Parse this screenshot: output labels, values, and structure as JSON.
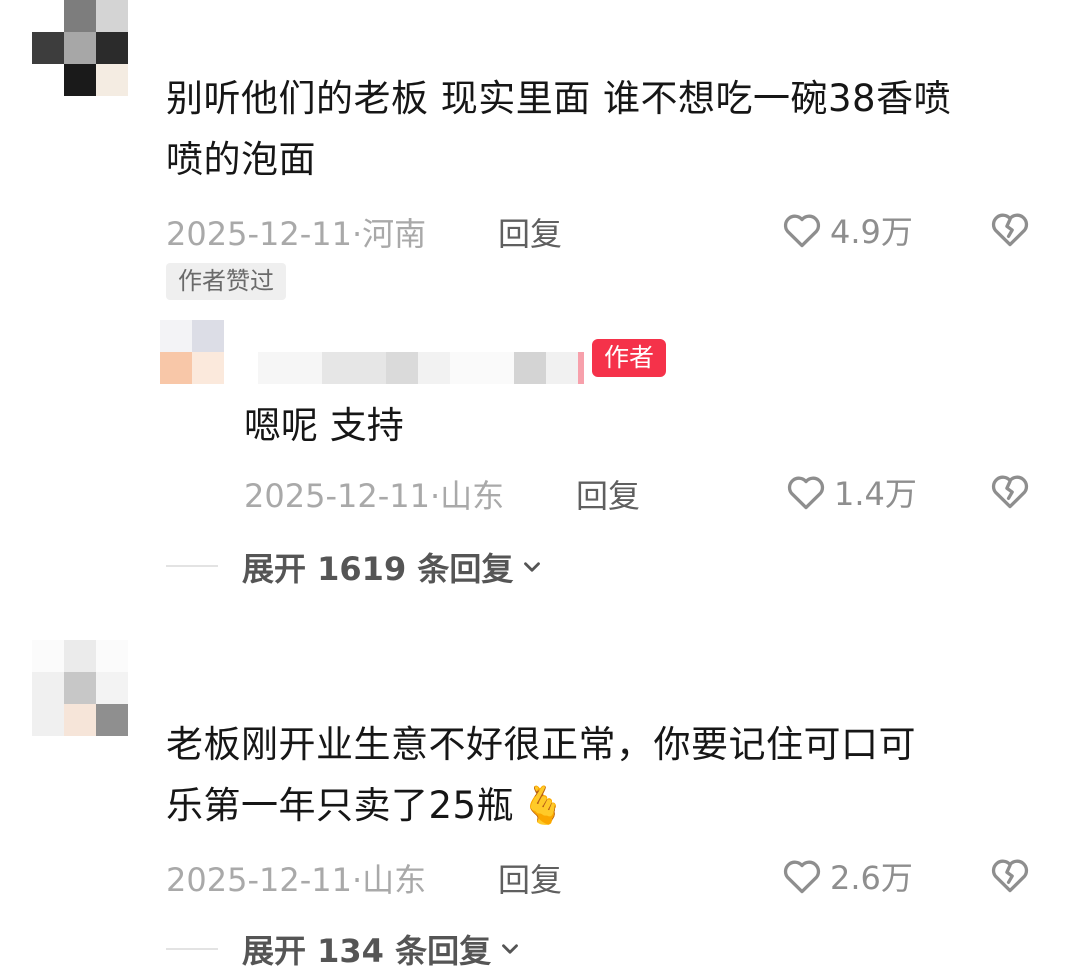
{
  "comments": [
    {
      "text_line1": "别听他们的老板 现实里面 谁不想吃一碗38香喷",
      "text_line2": "喷的泡面",
      "date": "2025-12-11",
      "location": "河南",
      "reply_label": "回复",
      "likes": "4.9万",
      "liked_by_author_label": "作者赞过",
      "author_reply": {
        "author_badge": "作者",
        "text": "嗯呢 支持",
        "date": "2025-12-11",
        "location": "山东",
        "reply_label": "回复",
        "likes": "1.4万"
      },
      "expand_label": "展开 1619 条回复"
    },
    {
      "text_line1": "老板刚开业生意不好很正常，你要记住可口可",
      "text_line2": "乐第一年只卖了25瓶",
      "emoji": "🫰",
      "date": "2025-12-11",
      "location": "山东",
      "reply_label": "回复",
      "likes": "2.6万",
      "expand_label": "展开 134 条回复"
    }
  ],
  "icons": {
    "like": "heart-outline-icon",
    "dislike": "broken-heart-icon",
    "expand": "chevron-down-icon"
  },
  "colors": {
    "author_badge": "#f5324a",
    "meta_text": "#a9a9a9",
    "reply_text": "#5f5f5f",
    "icon_gray": "#8e8e8e"
  }
}
